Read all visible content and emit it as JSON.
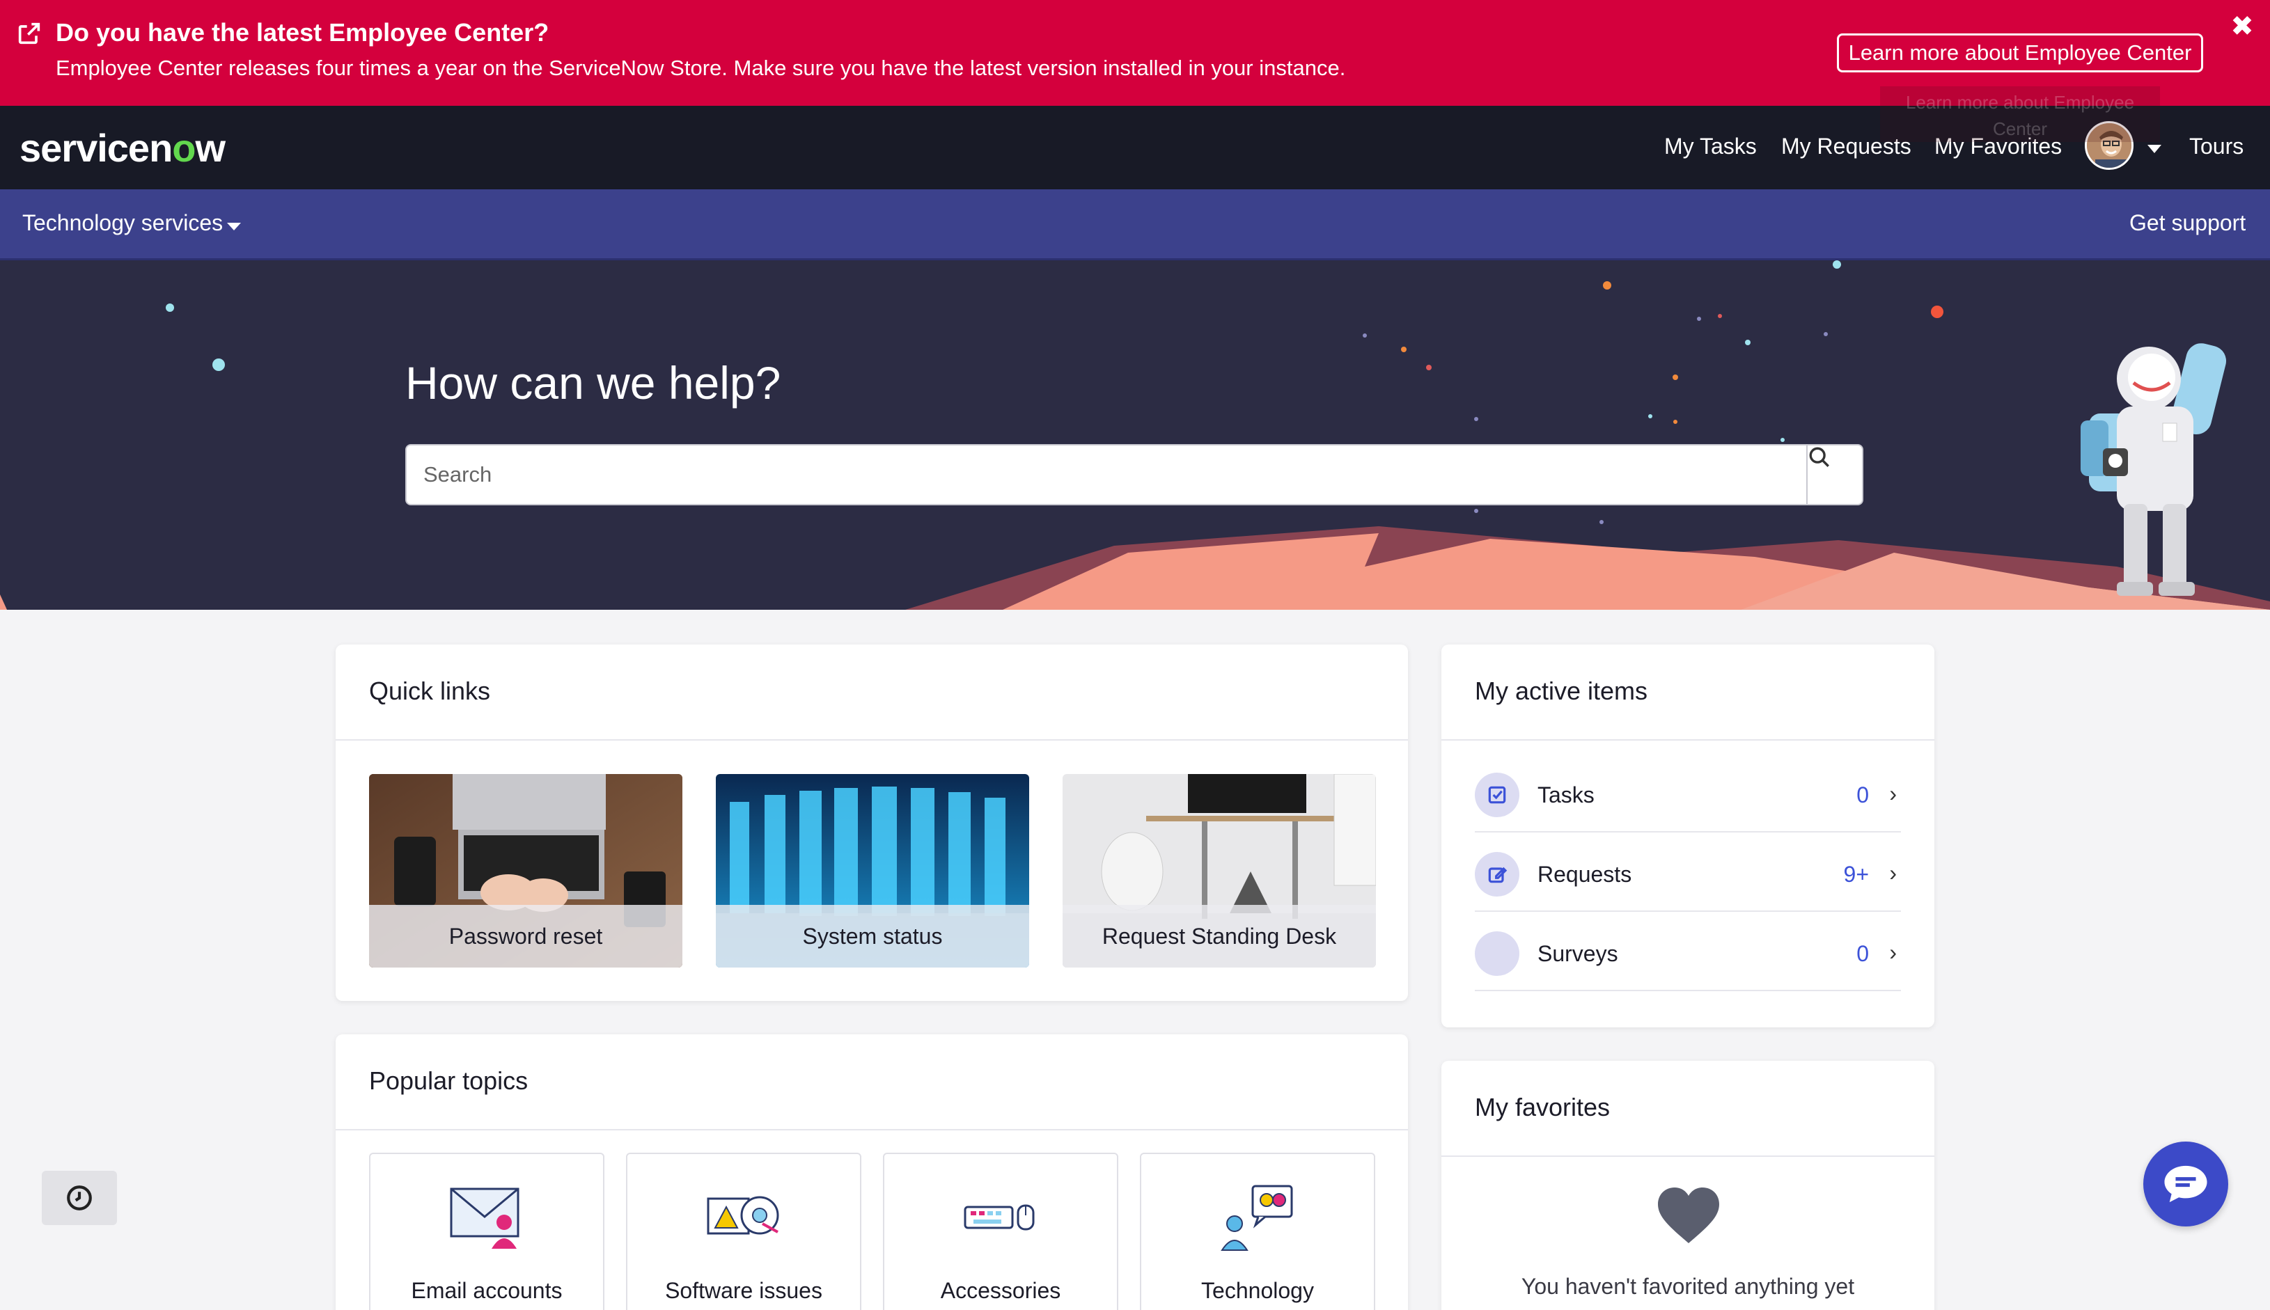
{
  "banner": {
    "title": "Do you have the latest Employee Center?",
    "text": "Employee Center releases four times a year on the ServiceNow Store. Make sure you have the latest version installed in your instance.",
    "button_label": "Learn more about Employee Center",
    "tooltip": "Learn more about Employee Center"
  },
  "header": {
    "logo_text": "servicen",
    "logo_o": "o",
    "logo_tail": "w",
    "nav": [
      "My Tasks",
      "My Requests",
      "My Favorites",
      "Tours"
    ]
  },
  "subnav": {
    "menu_label": "Technology services",
    "support_label": "Get support"
  },
  "hero": {
    "title": "How can we help?",
    "search_placeholder": "Search"
  },
  "quick_links": {
    "title": "Quick links",
    "items": [
      {
        "label": "Password reset"
      },
      {
        "label": "System status"
      },
      {
        "label": "Request Standing Desk"
      }
    ]
  },
  "active_items": {
    "title": "My active items",
    "rows": [
      {
        "label": "Tasks",
        "count": "0"
      },
      {
        "label": "Requests",
        "count": "9+"
      },
      {
        "label": "Surveys",
        "count": "0"
      }
    ]
  },
  "popular_topics": {
    "title": "Popular topics",
    "items": [
      {
        "label": "Email accounts"
      },
      {
        "label": "Software issues"
      },
      {
        "label": "Accessories"
      },
      {
        "label": "Technology"
      }
    ]
  },
  "favorites": {
    "title": "My favorites",
    "empty_text": "You haven't favorited anything yet"
  },
  "colors": {
    "banner": "#d4003d",
    "header": "#181a26",
    "subnav": "#3c418c",
    "accent": "#3c52d8"
  }
}
